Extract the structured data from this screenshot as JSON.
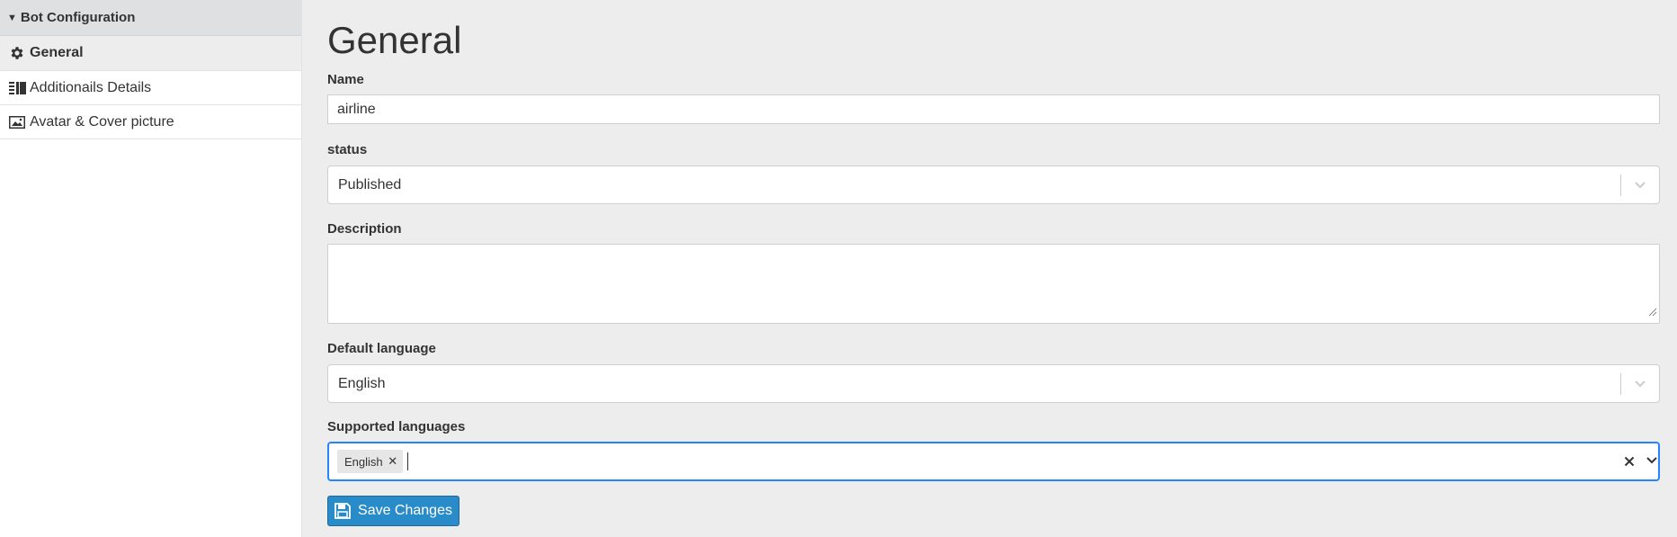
{
  "sidebar": {
    "header": "Bot Configuration",
    "items": [
      {
        "label": "General",
        "icon": "gear-icon",
        "active": true
      },
      {
        "label": "Additionails Details",
        "icon": "columns-icon",
        "active": false
      },
      {
        "label": "Avatar & Cover picture",
        "icon": "image-icon",
        "active": false
      }
    ]
  },
  "main": {
    "title": "General",
    "name": {
      "label": "Name",
      "value": "airline"
    },
    "status": {
      "label": "status",
      "value": "Published"
    },
    "description": {
      "label": "Description",
      "value": ""
    },
    "default_language": {
      "label": "Default language",
      "value": "English"
    },
    "supported_languages": {
      "label": "Supported languages",
      "selected": [
        "English"
      ]
    },
    "save_label": "Save Changes"
  },
  "colors": {
    "accent": "#2684ff",
    "button": "#2a8bc9",
    "background": "#ededed"
  }
}
